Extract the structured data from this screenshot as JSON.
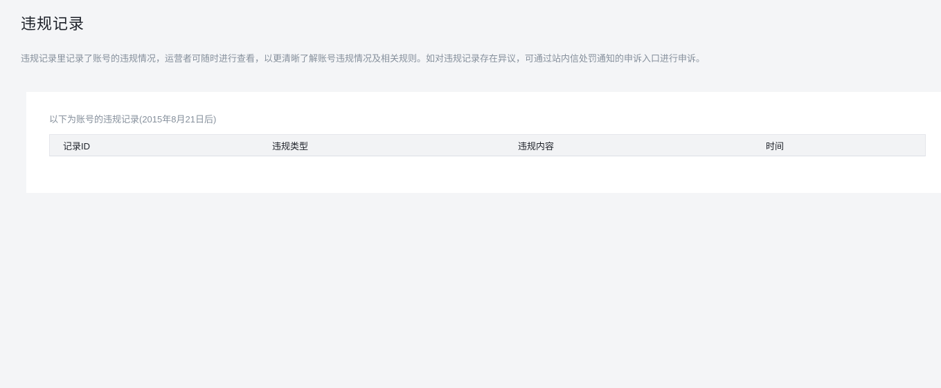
{
  "page": {
    "title": "违规记录",
    "description": "违规记录里记录了账号的违规情况，运营者可随时进行查看，以更清晰了解账号违规情况及相关规则。如对违规记录存在异议，可通过站内信处罚通知的申诉入口进行申诉。"
  },
  "records": {
    "intro": "以下为账号的违规记录(2015年8月21日后)",
    "table": {
      "columns": [
        "记录ID",
        "违规类型",
        "违规内容",
        "时间"
      ],
      "rows": []
    }
  },
  "colors": {
    "page_background": "#f4f5f7",
    "card_background": "#ffffff",
    "table_header_background": "#f2f3f5",
    "table_header_border": "#e5e6eb",
    "table_header_border_bottom": "#dcdfe5",
    "title_text": "#1d2129",
    "secondary_text": "#86909c",
    "header_text": "#1d2129"
  }
}
